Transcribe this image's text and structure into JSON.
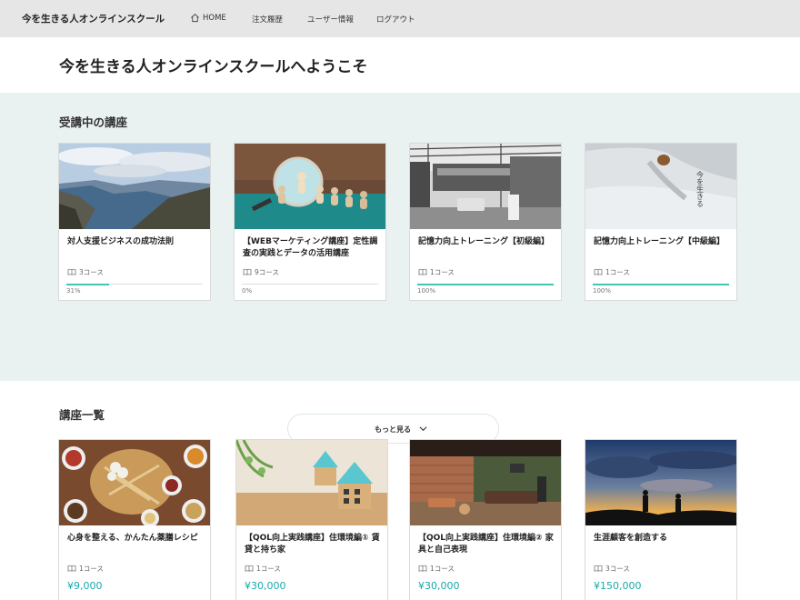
{
  "header": {
    "brand": "今を生きる人オンラインスクール",
    "nav": [
      "HOME",
      "注文履歴",
      "ユーザー情報",
      "ログアウト"
    ]
  },
  "welcome_title": "今を生きる人オンラインスクールへようこそ",
  "enrolled": {
    "title": "受講中の講座",
    "courses": [
      {
        "title": "対人支援ビジネスの成功法則",
        "meta": "3コース",
        "progress": 31,
        "progress_label": "31%"
      },
      {
        "title": "【WEBマーケティング講座】定性調査の実践とデータの活用講座",
        "meta": "9コース",
        "progress": 0,
        "progress_label": "0%"
      },
      {
        "title": "記憶力向上トレーニング【初級編】",
        "meta": "1コース",
        "progress": 100,
        "progress_label": "100%"
      },
      {
        "title": "記憶力向上トレーニング【中級編】",
        "meta": "1コース",
        "progress": 100,
        "progress_label": "100%"
      }
    ],
    "more_label": "もっと見る"
  },
  "catalog": {
    "title": "講座一覧",
    "courses": [
      {
        "title": "心身を整える、かんたん薬膳レシピ",
        "meta": "1コース",
        "price": "¥9,000"
      },
      {
        "title": "【QOL向上実践講座】住環境編① 賃貸と持ち家",
        "meta": "1コース",
        "price": "¥30,000"
      },
      {
        "title": "【QOL向上実践講座】住環境編② 家具と自己表現",
        "meta": "1コース",
        "price": "¥30,000"
      },
      {
        "title": "生涯顧客を創造する",
        "meta": "3コース",
        "price": "¥150,000"
      }
    ]
  },
  "thumbnail_text": "今を生きる",
  "colors": {
    "accent": "#3fc6b6",
    "price": "#19a8a8",
    "section_bg": "#e9f1f1",
    "header_bg": "#e6e6e6"
  },
  "icons": [
    "home-icon",
    "book-icon",
    "chevron-down-icon"
  ]
}
